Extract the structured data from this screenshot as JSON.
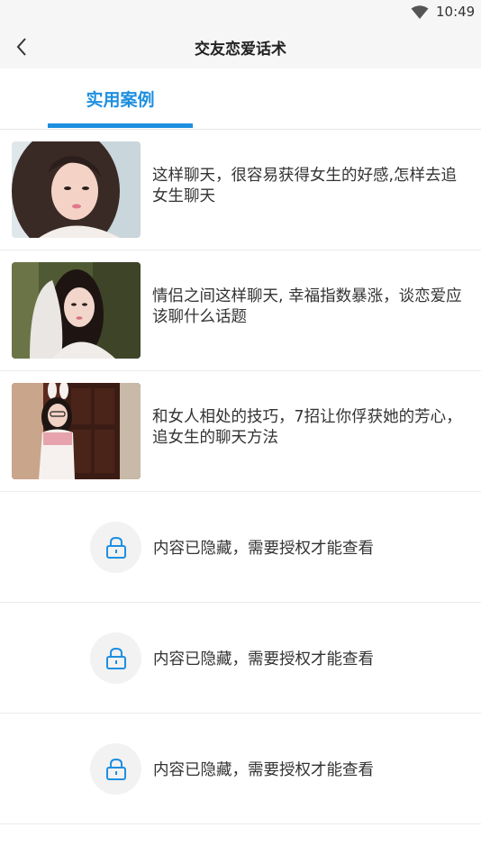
{
  "status_bar": {
    "time": "10:49",
    "wifi_icon": "wifi-icon"
  },
  "app_bar": {
    "back_icon": "back-arrow-icon",
    "title": "交友恋爱话术"
  },
  "tabs": [
    {
      "label": "实用案例",
      "selected": true
    }
  ],
  "colors": {
    "accent": "#1e8fe0",
    "lock": "#1e8fe0",
    "background": "#ffffff",
    "bar": "#f6f6f6"
  },
  "articles": [
    {
      "text": "这样聊天，很容易获得女生的好感,怎样去追女生聊天"
    },
    {
      "text": "情侣之间这样聊天, 幸福指数暴涨，谈恋爱应该聊什么话题"
    },
    {
      "text": "和女人相处的技巧，7招让你俘获她的芳心，追女生的聊天方法"
    }
  ],
  "locked_items": [
    {
      "icon": "lock-icon",
      "text": "内容已隐藏，需要授权才能查看"
    },
    {
      "icon": "lock-icon",
      "text": "内容已隐藏，需要授权才能查看"
    },
    {
      "icon": "lock-icon",
      "text": "内容已隐藏，需要授权才能查看"
    }
  ]
}
